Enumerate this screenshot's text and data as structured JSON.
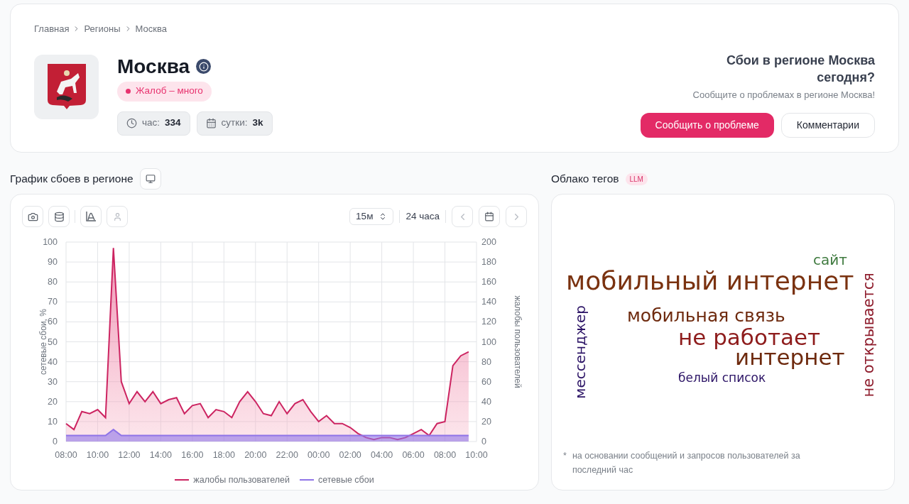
{
  "breadcrumb": [
    "Главная",
    "Регионы",
    "Москва"
  ],
  "region": {
    "title": "Москва",
    "status": {
      "label": "Жалоб – много",
      "color": "#e8336f"
    },
    "stats": [
      {
        "kind": "hour",
        "label": "час:",
        "value": "334"
      },
      {
        "kind": "day",
        "label": "сутки:",
        "value": "3k"
      }
    ]
  },
  "report": {
    "title": "Сбои в регионе Москва сегодня?",
    "subtitle": "Сообщите о проблемах в регионе Москва!",
    "buttons": [
      {
        "kind": "primary",
        "label": "Сообщить о проблеме"
      },
      {
        "kind": "secondary",
        "label": "Комментарии"
      }
    ]
  },
  "chart_panel": {
    "title": "График сбоев в регионе",
    "interval": "15м",
    "range": "24 часа",
    "chart_data": {
      "type": "area",
      "ylabel": "сетевые сбои, %",
      "y2label": "жалобы пользователей",
      "ylim": [
        0,
        100
      ],
      "y2lim": [
        0,
        200
      ],
      "yticks": [
        0,
        10,
        20,
        30,
        40,
        50,
        60,
        70,
        80,
        90,
        100
      ],
      "y2ticks": [
        0,
        20,
        40,
        60,
        80,
        100,
        120,
        140,
        160,
        180,
        200
      ],
      "grid": true,
      "legend": "bottom",
      "categories": [
        "08:00",
        null,
        null,
        null,
        "10:00",
        null,
        null,
        null,
        "12:00",
        null,
        null,
        null,
        "14:00",
        null,
        null,
        null,
        "16:00",
        null,
        null,
        null,
        "18:00",
        null,
        null,
        null,
        "20:00",
        null,
        null,
        null,
        "22:00",
        null,
        null,
        null,
        "00:00",
        null,
        null,
        null,
        "02:00",
        null,
        null,
        null,
        "04:00",
        null,
        null,
        null,
        "06:00",
        null,
        null,
        null,
        "08:00",
        null,
        null,
        null,
        "10:00"
      ],
      "series": [
        {
          "name": "жалобы пользователей",
          "color": "#cc2461",
          "axis": "y2",
          "values": [
            18,
            12,
            30,
            28,
            32,
            24,
            194,
            60,
            38,
            50,
            40,
            50,
            38,
            42,
            44,
            28,
            36,
            38,
            24,
            32,
            30,
            24,
            40,
            50,
            40,
            28,
            26,
            40,
            28,
            38,
            42,
            30,
            20,
            26,
            18,
            18,
            14,
            8,
            4,
            2,
            4,
            4,
            2,
            4,
            8,
            12,
            6,
            18,
            20,
            76,
            86,
            90,
            null
          ]
        },
        {
          "name": "сетевые сбои",
          "color": "#8f74e8",
          "values": [
            3,
            3,
            3,
            3,
            3,
            3,
            6,
            3,
            3,
            3,
            3,
            3,
            3,
            3,
            3,
            3,
            3,
            3,
            3,
            3,
            3,
            3,
            3,
            3,
            3,
            3,
            3,
            3,
            3,
            3,
            3,
            3,
            3,
            3,
            3,
            3,
            3,
            3,
            3,
            3,
            3,
            3,
            3,
            3,
            3,
            3,
            3,
            3,
            3,
            3,
            3,
            3,
            null
          ]
        }
      ]
    }
  },
  "tag_cloud": {
    "title": "Облако тегов",
    "badge": "LLM",
    "tags": [
      {
        "text": "сайт",
        "color": "#3f7a3f",
        "kind": "horizontal"
      },
      {
        "text": "мобильный интернет",
        "color": "#7a3210",
        "kind": "horizontal"
      },
      {
        "text": "мессенджер",
        "color": "#2c1466",
        "kind": "vertical"
      },
      {
        "text": "мобильная связь",
        "color": "#6e2a0e",
        "kind": "horizontal"
      },
      {
        "text": "не работает",
        "color": "#8e1c1c",
        "kind": "horizontal"
      },
      {
        "text": "интернет",
        "color": "#6e2a0e",
        "kind": "horizontal"
      },
      {
        "text": "белый список",
        "color": "#2c1466",
        "kind": "horizontal"
      },
      {
        "text": "не открывается",
        "color": "#8e1c2c",
        "kind": "vertical"
      }
    ],
    "footnote_mark": "*",
    "footnote": "на основании сообщений и запросов пользователей за последний час"
  }
}
